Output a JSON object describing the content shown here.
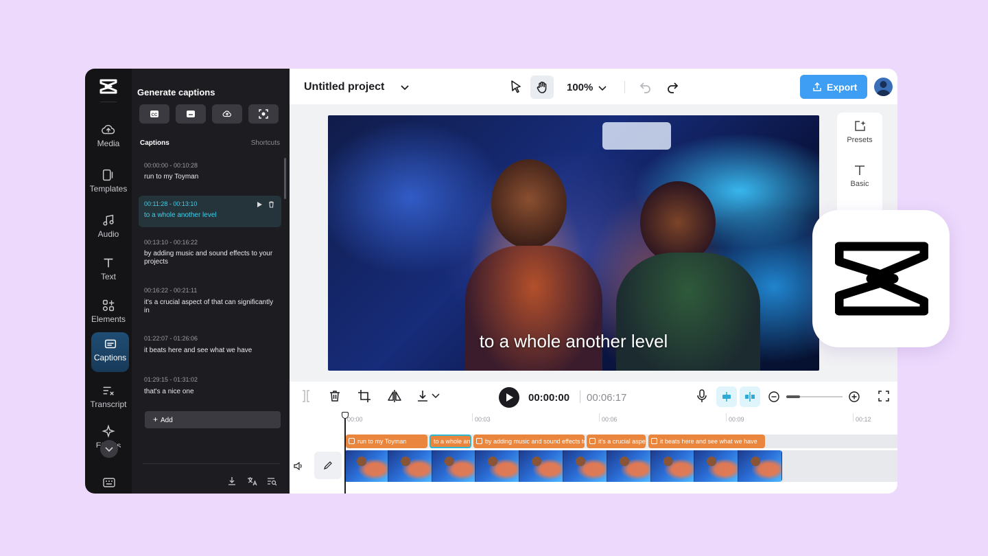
{
  "rail": {
    "items": [
      {
        "label": "Media",
        "icon": "cloud-upload-icon"
      },
      {
        "label": "Templates",
        "icon": "templates-icon"
      },
      {
        "label": "Audio",
        "icon": "music-note-icon"
      },
      {
        "label": "Text",
        "icon": "text-icon"
      },
      {
        "label": "Elements",
        "icon": "elements-icon"
      },
      {
        "label": "Captions",
        "icon": "captions-icon",
        "active": true
      },
      {
        "label": "Transcript",
        "icon": "transcript-icon"
      },
      {
        "label": "Effects",
        "icon": "sparkle-icon"
      }
    ]
  },
  "panel": {
    "title": "Generate captions",
    "section_label": "Captions",
    "shortcuts_label": "Shortcuts",
    "captions": [
      {
        "time": "00:00:00 - 00:10:28",
        "text": "run to my Toyman"
      },
      {
        "time": "00:11:28 - 00:13:10",
        "text": "to a whole another level",
        "active": true
      },
      {
        "time": "00:13:10 - 00:16:22",
        "text": "by adding music and sound effects to your projects"
      },
      {
        "time": "00:16:22 - 00:21:11",
        "text": "it's a crucial aspect of that can significantly in"
      },
      {
        "time": "01:22:07 - 01:26:06",
        "text": "it beats here and see what we have"
      },
      {
        "time": "01:29:15 - 01:31:02",
        "text": "that's a nice one"
      }
    ],
    "add_label": "Add"
  },
  "topbar": {
    "project_title": "Untitled project",
    "zoom": "100%",
    "export_label": "Export"
  },
  "canvas": {
    "subtitle": "to a whole another level"
  },
  "side_panel": {
    "items": [
      {
        "label": "Presets"
      },
      {
        "label": "Basic"
      }
    ]
  },
  "timeline": {
    "current_time": "00:00:00",
    "total_time": "00:06:17",
    "ticks": [
      "00:00",
      "00:03",
      "00:06",
      "00:09",
      "00:12"
    ],
    "caption_clips": [
      "run to my Toyman",
      "to a whole another level",
      "by adding music and sound effects to your projects",
      "it's a crucial aspect of that can significantly in",
      "it beats here and see what we have"
    ],
    "zoom_level": 0
  },
  "colors": {
    "accent": "#3d9ef4",
    "active_caption": "#3fd0e8",
    "caption_clip": "#e9853c",
    "background": "#ecd9fc"
  }
}
